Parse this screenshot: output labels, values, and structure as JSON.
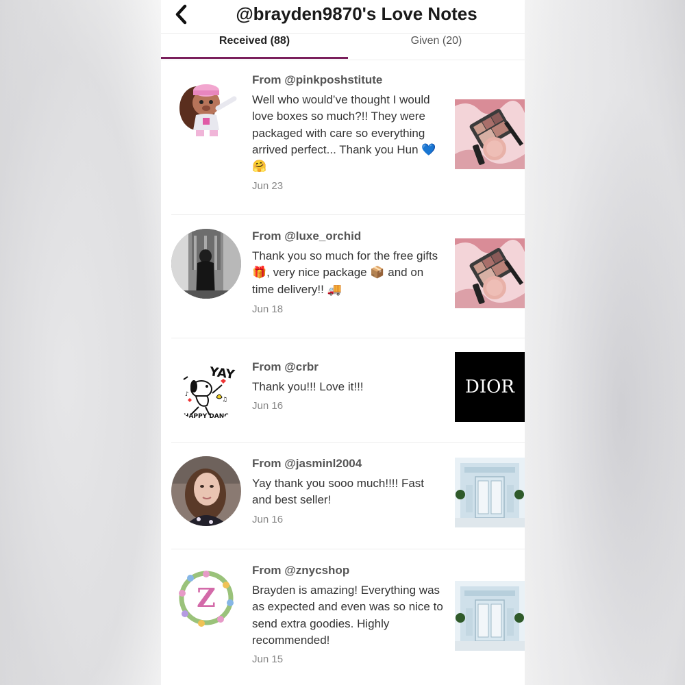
{
  "header": {
    "title": "@brayden9870's Love Notes",
    "back_icon": "chevron-left-icon"
  },
  "tabs": [
    {
      "label": "Received (88)",
      "active": true
    },
    {
      "label": "Given (20)",
      "active": false
    }
  ],
  "colors": {
    "accent": "#7a1f5c",
    "text_primary": "#1a1a1a",
    "text_muted": "#888888"
  },
  "notes": [
    {
      "from": "From @pinkposhstitute",
      "message": "Well who would’ve thought I would love boxes so much?!! They were packaged with care so everything arrived perfect... Thank you Hun 💙🤗",
      "date": "Jun 23",
      "avatar": "cartoon-bear-avatar",
      "thumbnail": "eyeshadow-palette-product"
    },
    {
      "from": "From @luxe_orchid",
      "message": "Thank you so much for the free gifts 🎁, very nice package 📦 and on time delivery!! 🚚",
      "date": "Jun 18",
      "avatar": "black-and-white-photo-avatar",
      "thumbnail": "eyeshadow-palette-product"
    },
    {
      "from": "From @crbr",
      "message": "Thank you!!! Love it!!!",
      "date": "Jun 16",
      "avatar": "snoopy-happy-dance-avatar",
      "avatar_text_top": "YAY",
      "avatar_text_bottom": "HAPPY DANCE",
      "thumbnail": "dior-logo",
      "thumbnail_text": "DIOR"
    },
    {
      "from": "From @jasminl2004",
      "message": "Yay thank you sooo much!!!! Fast and best seller!",
      "date": "Jun 16",
      "avatar": "selfie-photo-avatar",
      "thumbnail": "storefront-photo"
    },
    {
      "from": "From @znycshop",
      "message": "Brayden is amazing! Everything was as expected and even was so nice to send extra goodies. Highly recommended!",
      "date": "Jun 15",
      "avatar": "floral-letter-avatar",
      "avatar_letter": "Z",
      "thumbnail": "storefront-photo"
    }
  ]
}
